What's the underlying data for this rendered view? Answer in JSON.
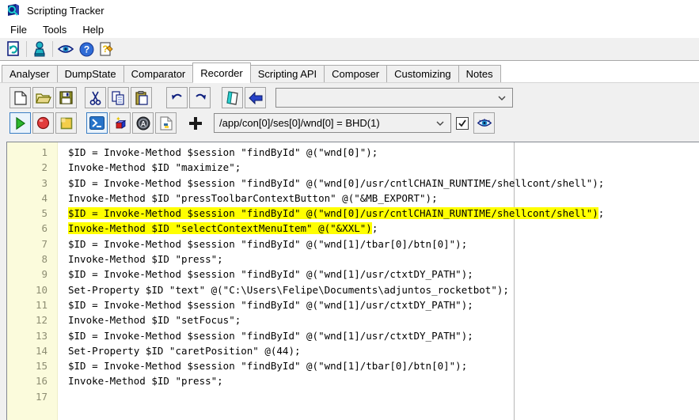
{
  "window": {
    "title": "Scripting Tracker"
  },
  "menu": {
    "items": [
      "File",
      "Tools",
      "Help"
    ]
  },
  "main_toolbar": {
    "buttons": [
      "refresh-script",
      "session",
      "watch-eye",
      "help",
      "context-help"
    ]
  },
  "tabs": {
    "items": [
      "Analyser",
      "DumpState",
      "Comparator",
      "Recorder",
      "Scripting API",
      "Composer",
      "Customizing",
      "Notes"
    ],
    "active_index": 3
  },
  "edit_toolbar": {
    "buttons": [
      "new-file",
      "open-file",
      "save-file",
      "cut",
      "copy",
      "paste",
      "undo",
      "redo",
      "notes",
      "import"
    ],
    "script_combo": {
      "value": "",
      "placeholder": ""
    }
  },
  "run_toolbar": {
    "buttons": [
      "play",
      "record",
      "stop",
      "powershell",
      "vb-cube",
      "autoit",
      "python-script",
      "add"
    ],
    "toggled": [
      "play",
      "powershell"
    ],
    "target_combo": {
      "value": "/app/con[0]/ses[0]/wnd[0] = BHD(1)"
    },
    "checkbox_checked": true,
    "eye_button": "watch-eye"
  },
  "icons": {
    "app-icon": "svg-logo",
    "chevron-down-icon": "svg-chevron",
    "checkmark-icon": "svg-check"
  },
  "colors": {
    "highlight": "#ffff00",
    "gutter": "#fbfbdc",
    "toggle_border": "#3b7fc4",
    "toolbar_bg": "#f0f0f0"
  },
  "editor": {
    "lines": [
      {
        "num": 1,
        "text": "$ID = Invoke-Method $session \"findById\" @(\"wnd[0]\");",
        "hl": false
      },
      {
        "num": 2,
        "text": "Invoke-Method $ID \"maximize\";",
        "hl": false
      },
      {
        "num": 3,
        "text": "$ID = Invoke-Method $session \"findById\" @(\"wnd[0]/usr/cntlCHAIN_RUNTIME/shellcont/shell\");",
        "hl": false
      },
      {
        "num": 4,
        "text": "Invoke-Method $ID \"pressToolbarContextButton\" @(\"&MB_EXPORT\");",
        "hl": false
      },
      {
        "num": 5,
        "text": "$ID = Invoke-Method $session \"findById\" @(\"wnd[0]/usr/cntlCHAIN_RUNTIME/shellcont/shell\");",
        "hl": true
      },
      {
        "num": 6,
        "text": "Invoke-Method $ID \"selectContextMenuItem\" @(\"&XXL\");",
        "hl": true
      },
      {
        "num": 7,
        "text": "$ID = Invoke-Method $session \"findById\" @(\"wnd[1]/tbar[0]/btn[0]\");",
        "hl": false
      },
      {
        "num": 8,
        "text": "Invoke-Method $ID \"press\";",
        "hl": false
      },
      {
        "num": 9,
        "text": "$ID = Invoke-Method $session \"findById\" @(\"wnd[1]/usr/ctxtDY_PATH\");",
        "hl": false
      },
      {
        "num": 10,
        "text": "Set-Property $ID \"text\" @(\"C:\\Users\\Felipe\\Documents\\adjuntos_rocketbot\");",
        "hl": false
      },
      {
        "num": 11,
        "text": "$ID = Invoke-Method $session \"findById\" @(\"wnd[1]/usr/ctxtDY_PATH\");",
        "hl": false
      },
      {
        "num": 12,
        "text": "Invoke-Method $ID \"setFocus\";",
        "hl": false
      },
      {
        "num": 13,
        "text": "$ID = Invoke-Method $session \"findById\" @(\"wnd[1]/usr/ctxtDY_PATH\");",
        "hl": false
      },
      {
        "num": 14,
        "text": "Set-Property $ID \"caretPosition\" @(44);",
        "hl": false
      },
      {
        "num": 15,
        "text": "$ID = Invoke-Method $session \"findById\" @(\"wnd[1]/tbar[0]/btn[0]\");",
        "hl": false
      },
      {
        "num": 16,
        "text": "Invoke-Method $ID \"press\";",
        "hl": false
      },
      {
        "num": 17,
        "text": "",
        "hl": false
      }
    ]
  }
}
